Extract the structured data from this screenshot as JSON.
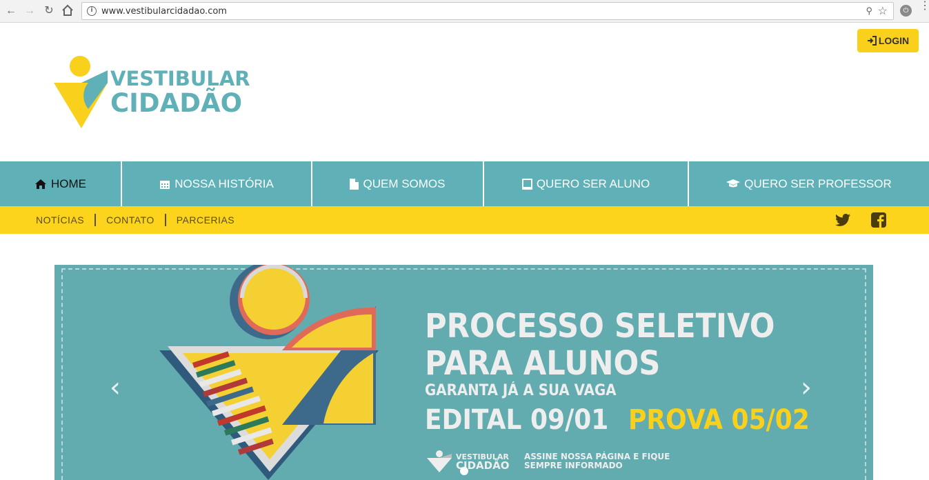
{
  "browser": {
    "url": "www.vestibularcidadao.com",
    "icons": [
      "back-icon",
      "forward-icon",
      "reload-icon",
      "home-icon",
      "info-icon",
      "key-icon",
      "star-icon",
      "power-icon",
      "menu-icon"
    ]
  },
  "header": {
    "login_label": "LOGIN",
    "logo_line1": "VESTIBULAR",
    "logo_line2": "CIDADÃO"
  },
  "mainnav": {
    "items": [
      {
        "label": "HOME",
        "icon": "home-icon"
      },
      {
        "label": "NOSSA HISTÓRIA",
        "icon": "calendar-icon"
      },
      {
        "label": "QUEM SOMOS",
        "icon": "document-icon"
      },
      {
        "label": "QUERO SER ALUNO",
        "icon": "book-icon"
      },
      {
        "label": "QUERO SER PROFESSOR",
        "icon": "graduation-cap-icon"
      }
    ]
  },
  "subnav": {
    "links": [
      "NOTÍCIAS",
      "CONTATO",
      "PARCERIAS"
    ],
    "social": [
      "twitter-icon",
      "facebook-icon"
    ]
  },
  "slider": {
    "heading_line1": "PROCESSO SELETIVO",
    "heading_line2": "PARA ALUNOS",
    "subheading": "GARANTA JÁ A SUA VAGA",
    "edital": "EDITAL 09/01",
    "prova": "PROVA 05/02",
    "mini_brand_line1": "VESTIBULAR",
    "mini_brand_line2": "CIDADÃO",
    "assine": "ASSINE NOSSA PÁGINA E FIQUE SEMPRE INFORMADO"
  },
  "colors": {
    "teal": "#5fb0b7",
    "yellow": "#fcd41b",
    "slider_bg": "#62abaf"
  }
}
